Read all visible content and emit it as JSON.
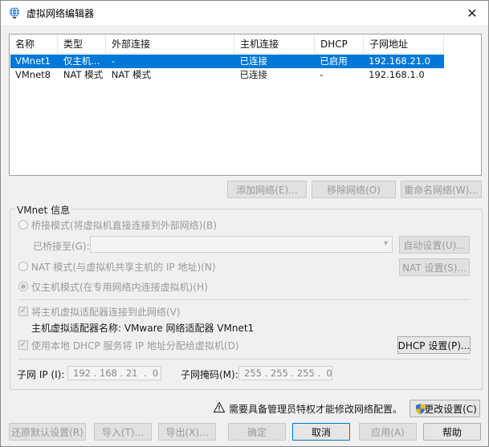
{
  "window": {
    "title": "虚拟网络编辑器",
    "close_glyph": "✕"
  },
  "table": {
    "headers": [
      "名称",
      "类型",
      "外部连接",
      "主机连接",
      "DHCP",
      "子网地址"
    ],
    "rows": [
      {
        "name": "VMnet1",
        "type": "仅主机...",
        "external": "-",
        "host": "已连接",
        "dhcp": "已启用",
        "subnet": "192.168.21.0",
        "selected": true
      },
      {
        "name": "VMnet8",
        "type": "NAT 模式",
        "external": "NAT 模式",
        "host": "已连接",
        "dhcp": "-",
        "subnet": "192.168.1.0",
        "selected": false
      }
    ]
  },
  "network_buttons": {
    "add": "添加网络(E)...",
    "remove": "移除网络(O)",
    "rename": "重命名网络(W)..."
  },
  "vmnet_info": {
    "label": "VMnet 信息",
    "bridged_mode": "桥接模式(将虚拟机直接连接到外部网络)(B)",
    "bridged_to_label": "已桥接至(G):",
    "auto_settings": "自动设置(U)...",
    "nat_mode": "NAT 模式(与虚拟机共享主机的 IP 地址)(N)",
    "nat_settings": "NAT 设置(S)...",
    "host_only_mode": "仅主机模式(在专用网络内连接虚拟机)(H)",
    "connect_adapter": "将主机虚拟适配器连接到此网络(V)",
    "adapter_name": "主机虚拟适配器名称: VMware 网络适配器 VMnet1",
    "use_dhcp": "使用本地 DHCP 服务将 IP 地址分配给虚拟机(D)",
    "dhcp_settings": "DHCP 设置(P)...",
    "subnet_ip_label": "子网 IP (I):",
    "subnet_ip_value": "192 . 168 . 21  .  0",
    "subnet_mask_label": "子网掩码(M):",
    "subnet_mask_value": "255 . 255 . 255 .  0"
  },
  "admin_notice": "需要具备管理员特权才能修改网络配置。",
  "change_settings": "更改设置(C)",
  "footer_buttons": {
    "restore": "还原默认设置(R)",
    "import": "导入(T)...",
    "export": "导出(X)...",
    "ok": "确定",
    "cancel": "取消",
    "apply": "应用(A)",
    "help": "帮助"
  }
}
